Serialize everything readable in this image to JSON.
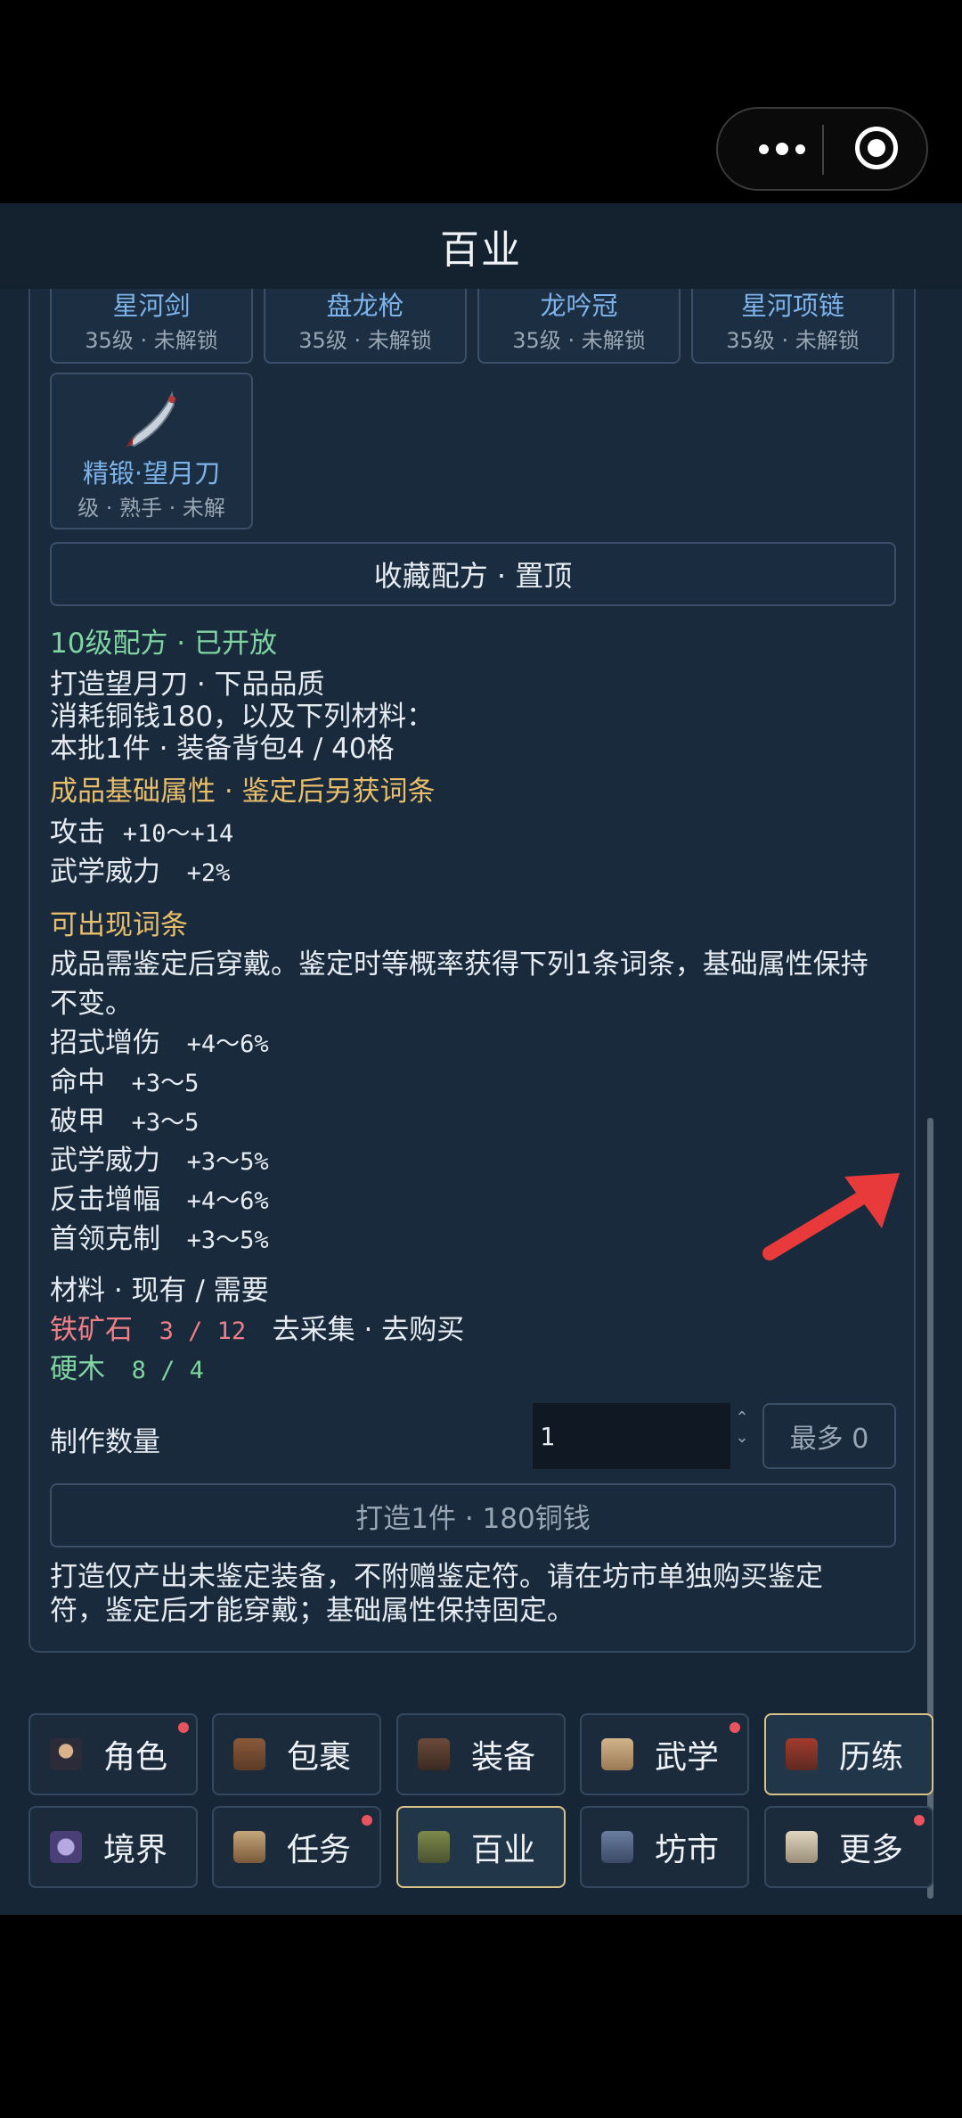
{
  "header": {
    "title": "百业"
  },
  "recipe_cards": [
    {
      "name": "星河剑",
      "status": "35级 · 未解锁"
    },
    {
      "name": "盘龙枪",
      "status": "35级 · 未解锁"
    },
    {
      "name": "龙吟冠",
      "status": "35级 · 未解锁"
    },
    {
      "name": "星河项链",
      "status": "35级 · 未解锁"
    },
    {
      "name": "精锻·望月刀",
      "status": "级 · 熟手 · 未解",
      "icon": "blade-icon"
    }
  ],
  "pin_button": "收藏配方 · 置顶",
  "recipe": {
    "level_line": "10级配方 · 已开放",
    "craft_line": "打造望月刀 · 下品品质",
    "cost_line": "消耗铜钱180，以及下列材料：",
    "batch_line": "本批1件 · 装备背包4 / 40格",
    "base_title": "成品基础属性 · 鉴定后另获词条",
    "base_attrs": [
      {
        "name": "攻击",
        "value": "+10～+14"
      },
      {
        "name": "武学威力",
        "value": "+2%"
      }
    ],
    "affix_title": "可出现词条",
    "affix_desc": [
      "成品需鉴定后穿戴。鉴定时等概率获得下列1条词条，基础属性保持",
      "不变。"
    ],
    "affixes": [
      {
        "name": "招式增伤",
        "value": "+4～6%"
      },
      {
        "name": "命中",
        "value": "+3～5"
      },
      {
        "name": "破甲",
        "value": "+3～5"
      },
      {
        "name": "武学威力",
        "value": "+3～5%"
      },
      {
        "name": "反击增幅",
        "value": "+4～6%"
      },
      {
        "name": "首领克制",
        "value": "+3～5%"
      }
    ],
    "materials_title": "材料 · 现有 / 需要",
    "materials": [
      {
        "name": "铁矿石",
        "count": "3 / 12",
        "actions": "去采集 · 去购买",
        "color": "#ef7f87"
      },
      {
        "name": "硬木",
        "count": "8 / 4",
        "actions": "",
        "color": "#7fd4a0"
      }
    ],
    "quantity_label": "制作数量",
    "quantity_value": "1",
    "max_button": "最多 0",
    "craft_button": "打造1件 · 180铜钱",
    "footer_note": [
      "打造仅产出未鉴定装备，不附赠鉴定符。请在坊市单独购买鉴定",
      "符，鉴定后才能穿戴；基础属性保持固定。"
    ]
  },
  "nav": [
    {
      "label": "角色",
      "icon": "character-icon",
      "badge": true,
      "active": false
    },
    {
      "label": "包裹",
      "icon": "bag-icon",
      "badge": false,
      "active": false
    },
    {
      "label": "装备",
      "icon": "equipment-icon",
      "badge": false,
      "active": false
    },
    {
      "label": "武学",
      "icon": "scroll-icon",
      "badge": true,
      "active": false
    },
    {
      "label": "历练",
      "icon": "training-icon",
      "badge": false,
      "active": true
    },
    {
      "label": "境界",
      "icon": "realm-icon",
      "badge": false,
      "active": false
    },
    {
      "label": "任务",
      "icon": "task-icon",
      "badge": true,
      "active": false
    },
    {
      "label": "百业",
      "icon": "crafting-icon",
      "badge": false,
      "active": true
    },
    {
      "label": "坊市",
      "icon": "market-icon",
      "badge": false,
      "active": false
    },
    {
      "label": "更多",
      "icon": "more-icon",
      "badge": true,
      "active": false
    }
  ],
  "colors": {
    "accent_green": "#7fd4a0",
    "accent_gold": "#e8be6b",
    "alert_red": "#ef7f87",
    "badge_red": "#e8535f",
    "active_border": "#d8c28a"
  }
}
